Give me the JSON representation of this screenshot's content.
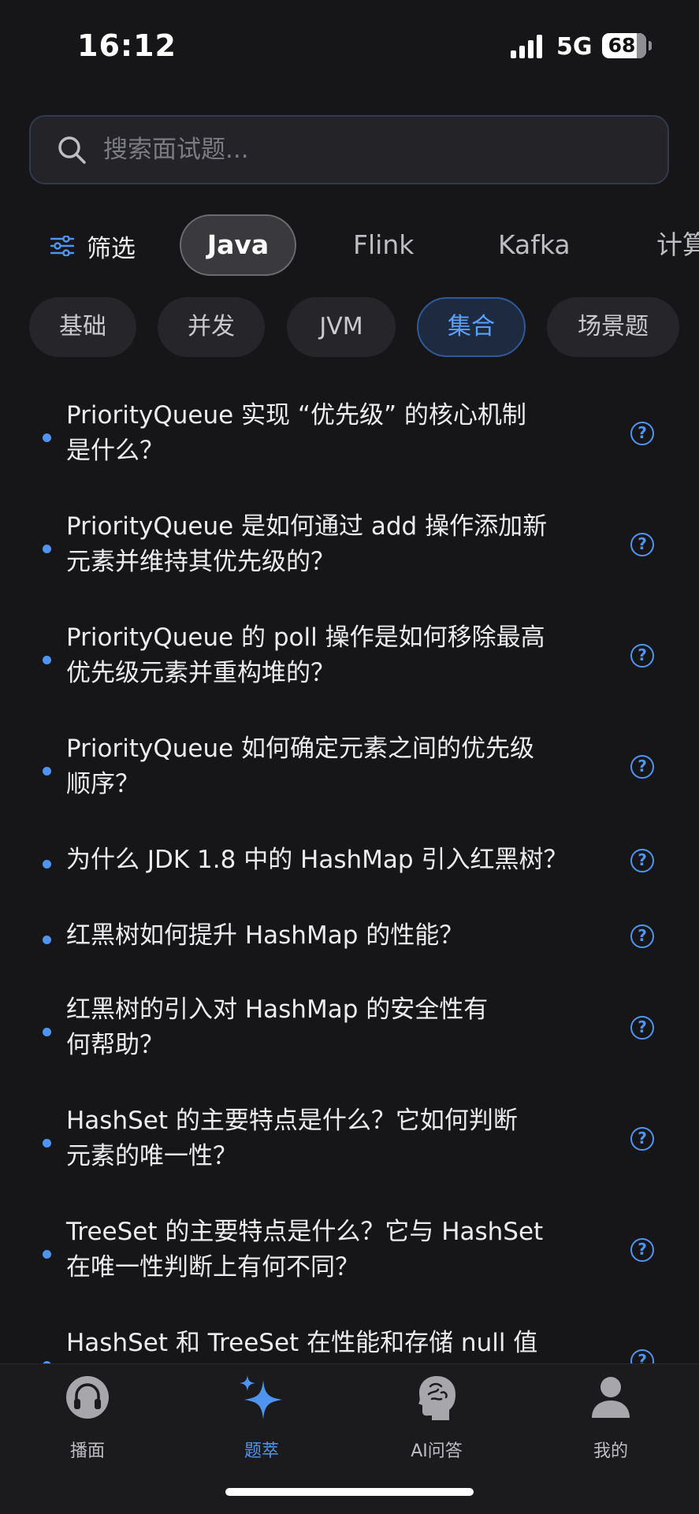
{
  "status_bar": {
    "time": "16:12",
    "network": "5G",
    "battery": "68"
  },
  "search": {
    "placeholder": "搜索面试题..."
  },
  "filter": {
    "label": "筛选"
  },
  "language_tabs": [
    {
      "label": "Java",
      "active": true
    },
    {
      "label": "Flink",
      "active": false
    },
    {
      "label": "Kafka",
      "active": false
    },
    {
      "label": "计算",
      "active": false
    }
  ],
  "category_chips": [
    {
      "label": "基础",
      "active": false
    },
    {
      "label": "并发",
      "active": false
    },
    {
      "label": "JVM",
      "active": false
    },
    {
      "label": "集合",
      "active": true
    },
    {
      "label": "场景题",
      "active": false
    }
  ],
  "questions": [
    {
      "lines": [
        "PriorityQueue 实现 “优先级” 的核心机制",
        "是什么？"
      ]
    },
    {
      "lines": [
        "PriorityQueue 是如何通过 add 操作添加新",
        "元素并维持其优先级的？"
      ]
    },
    {
      "lines": [
        "PriorityQueue 的 poll 操作是如何移除最高",
        "优先级元素并重构堆的？"
      ]
    },
    {
      "lines": [
        "PriorityQueue 如何确定元素之间的优先级",
        "顺序？"
      ]
    },
    {
      "lines": [
        "为什么 JDK 1.8 中的 HashMap 引入红黑树？"
      ]
    },
    {
      "lines": [
        "红黑树如何提升 HashMap 的性能？"
      ]
    },
    {
      "lines": [
        "红黑树的引入对 HashMap 的安全性有",
        "何帮助？"
      ]
    },
    {
      "lines": [
        "HashSet 的主要特点是什么？它如何判断",
        "元素的唯一性？"
      ]
    },
    {
      "lines": [
        "TreeSet 的主要特点是什么？它与 HashSet",
        "在唯一性判断上有何不同？"
      ]
    },
    {
      "lines": [
        "HashSet 和 TreeSet 在性能和存储 null 值",
        ""
      ]
    }
  ],
  "question_help_symbol": "?",
  "bottom_nav": [
    {
      "label": "播面",
      "icon": "headphones-icon",
      "active": false
    },
    {
      "label": "题萃",
      "icon": "sparkle-icon",
      "active": true
    },
    {
      "label": "AI问答",
      "icon": "ai-brain-icon",
      "active": false
    },
    {
      "label": "我的",
      "icon": "user-icon",
      "active": false
    }
  ],
  "colors": {
    "background": "#161618",
    "accent": "#4f95f0",
    "active_chip_bg": "#1d2a40"
  }
}
